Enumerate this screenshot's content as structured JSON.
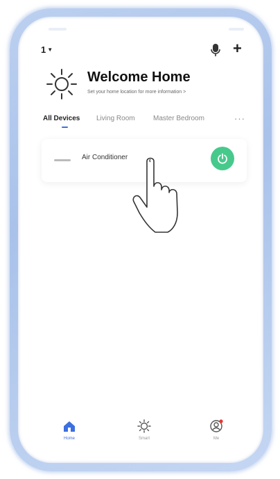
{
  "header": {
    "home_selector": "1",
    "icons": {
      "voice": "microphone-icon",
      "add": "plus-icon"
    }
  },
  "welcome": {
    "title": "Welcome Home",
    "subtitle": "Set your home location for more information  >",
    "icon": "sun-icon"
  },
  "tabs": [
    {
      "label": "All Devices",
      "active": true
    },
    {
      "label": "Living Room",
      "active": false
    },
    {
      "label": "Master Bedroom",
      "active": false
    }
  ],
  "tabs_more": "···",
  "devices": [
    {
      "name": "Air Conditioner",
      "icon": "air-conditioner-icon",
      "power_color": "#47c98c"
    }
  ],
  "bottom_nav": [
    {
      "label": "Home",
      "icon": "home-icon",
      "active": true
    },
    {
      "label": "Smart",
      "icon": "smart-sun-icon",
      "active": false
    },
    {
      "label": "Me",
      "icon": "profile-icon",
      "active": false
    }
  ],
  "colors": {
    "accent": "#3c6fe0",
    "power_button": "#47c98c",
    "notification_dot": "#e53935",
    "frame": "#b3c9ee"
  },
  "overlay": {
    "icon": "tapping-hand-icon"
  }
}
